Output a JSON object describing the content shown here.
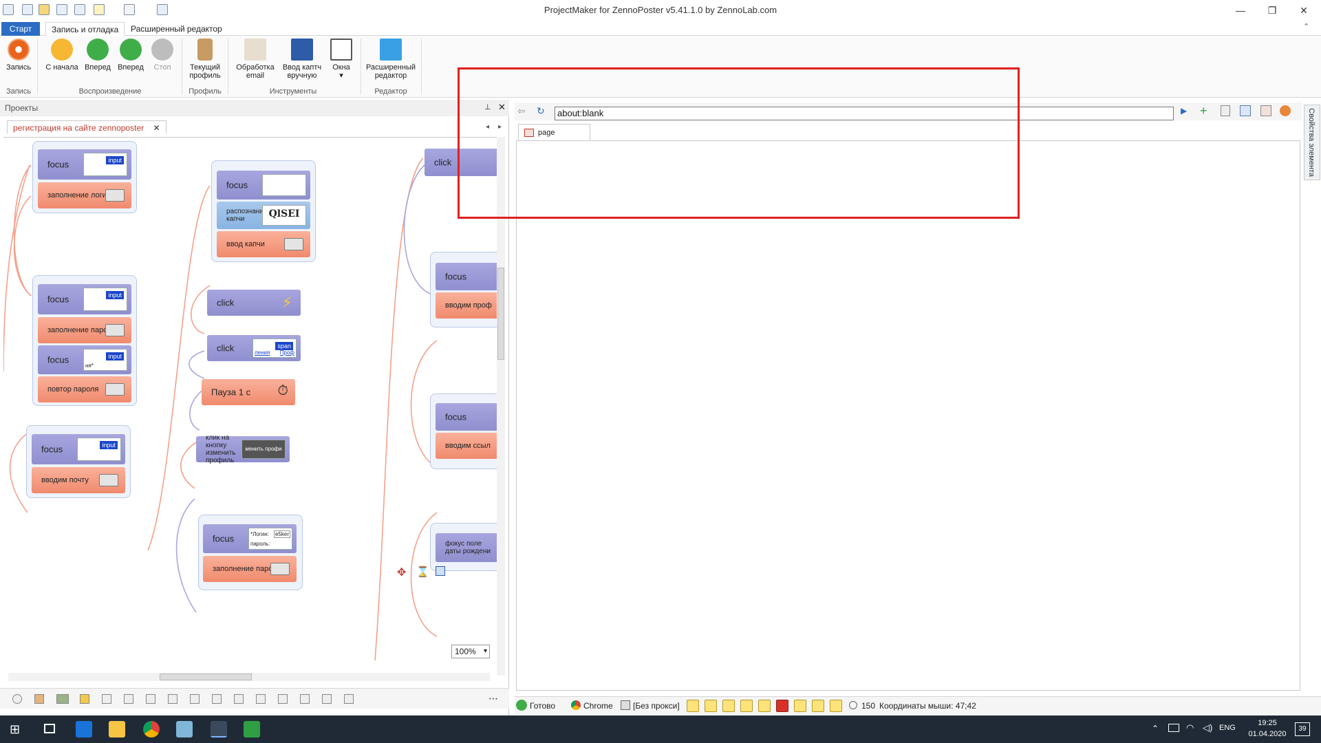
{
  "window": {
    "title": "ProjectMaker for ZennoPoster v5.41.1.0 by ZennoLab.com",
    "minimize": "—",
    "restore": "❐",
    "close": "✕"
  },
  "ribbon_tabs": [
    "Старт",
    "Запись и отладка",
    "Расширенный редактор"
  ],
  "ribbon": {
    "record_label": "Запись",
    "from_start_label": "С начала",
    "forward_label": "Вперед",
    "forward2_label": "Вперед",
    "stop_label": "Стоп",
    "profile_label_1": "Текущий",
    "profile_label_2": "профиль",
    "email_label_1": "Обработка",
    "email_label_2": "email",
    "captcha_label_1": "Ввод каптч",
    "captcha_label_2": "вручную",
    "windows_label": "Окна",
    "ext_editor_label_1": "Расширенный",
    "ext_editor_label_2": "редактор",
    "groups": {
      "record": "Запись",
      "playback": "Воспроизведение",
      "profile": "Профиль",
      "tools": "Инструменты",
      "editor": "Редактор"
    }
  },
  "left_pane": {
    "header": "Проекты",
    "doc_tab": "регистрация на сайте zennoposter",
    "zoom": "100%"
  },
  "nodes": {
    "n1": "focus",
    "n2": "заполнение логина",
    "n3": "focus",
    "n4": "заполнение пароля",
    "n5": "focus",
    "n6": "повтор пароля",
    "n7": "focus",
    "n8": "вводим почту",
    "n9": "focus",
    "n10": "распознание капчи",
    "n11": "ввод капчи",
    "n12": "click",
    "n13": "click",
    "n14": "Пауза 1 с",
    "n15": "клик на кнопку изменить профиль",
    "n16": "focus",
    "n17": "заполнение пароля",
    "n18": "click",
    "n19": "focus",
    "n20": "вводим проф",
    "n21": "focus",
    "n22": "вводим ссыл",
    "n23": "фокус поле даты рождени"
  },
  "thumb_tags": {
    "input": "input",
    "span": "span",
    "n5_text": "ня*",
    "n13_text1": "ления",
    "n13_text2": "Проф",
    "n15_text": "менить профи",
    "n16_line1": "*Логин:",
    "n16_val1": "e5ker",
    "n16_line2": "пароль:",
    "captcha_text": "QlSEI"
  },
  "browser": {
    "address": "about:blank",
    "page_tab": "page",
    "side_panel": "Свойства элемента"
  },
  "status": {
    "ready": "Готово",
    "browser": "Chrome",
    "proxy": "[Без прокси]",
    "count": "150",
    "mouse": "Координаты мыши: 47;42"
  },
  "taskbar": {
    "lang": "ENG",
    "time": "19:25",
    "date": "01.04.2020",
    "notif": "39"
  }
}
